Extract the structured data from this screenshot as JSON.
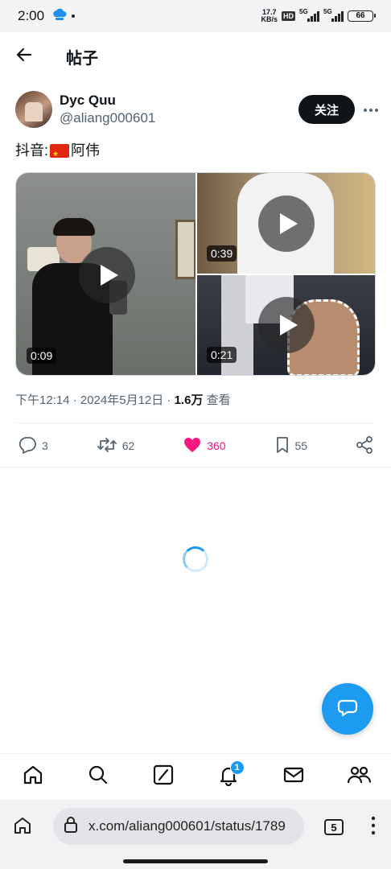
{
  "status_bar": {
    "time": "2:00",
    "net_speed_value": "17.7",
    "net_speed_unit": "KB/s",
    "hd_label": "HD",
    "sim1_label": "5G",
    "sim2_label": "5G",
    "battery": "66"
  },
  "header": {
    "title": "帖子"
  },
  "post": {
    "author": {
      "display_name": "Dyc Quu",
      "handle": "@aliang000601"
    },
    "follow_label": "关注",
    "text_prefix": "抖音:",
    "text_suffix": "阿伟",
    "media": [
      {
        "duration": "0:09"
      },
      {
        "duration": "0:39"
      },
      {
        "duration": "0:21"
      }
    ],
    "meta": {
      "time_date": "下午12:14 · 2024年5月12日 · ",
      "views": "1.6万",
      "views_suffix": " 查看"
    },
    "actions": {
      "replies": "3",
      "reposts": "62",
      "likes": "360",
      "bookmarks": "55"
    }
  },
  "tabbar": {
    "notifications_badge": "1"
  },
  "browser": {
    "url": "x.com/aliang000601/status/1789",
    "tab_count": "5"
  },
  "colors": {
    "accent": "#1d9bf0",
    "like": "#f91880",
    "text_primary": "#0f1419",
    "text_secondary": "#536471"
  }
}
